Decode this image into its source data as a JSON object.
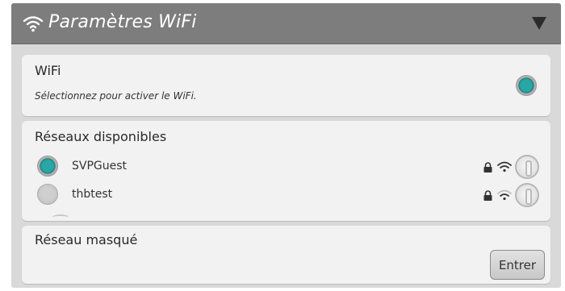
{
  "header": {
    "title": "Paramètres WiFi",
    "wifi_icon": "wifi-icon",
    "collapse_icon": "caret-down-icon"
  },
  "wifi_card": {
    "label": "WiFi",
    "sublabel": "Sélectionnez pour activer le WiFi.",
    "enabled": true
  },
  "networks_card": {
    "label": "Réseaux disponibles",
    "networks": [
      {
        "name": "SVPGuest",
        "selected": true,
        "secured": true
      },
      {
        "name": "thbtest",
        "selected": false,
        "secured": true
      }
    ]
  },
  "hidden_card": {
    "label": "Réseau masqué",
    "button_label": "Entrer"
  },
  "colors": {
    "accent": "#2aa6a6",
    "header_bg": "#7d7d7d",
    "card_bg": "#f2f2f2"
  }
}
